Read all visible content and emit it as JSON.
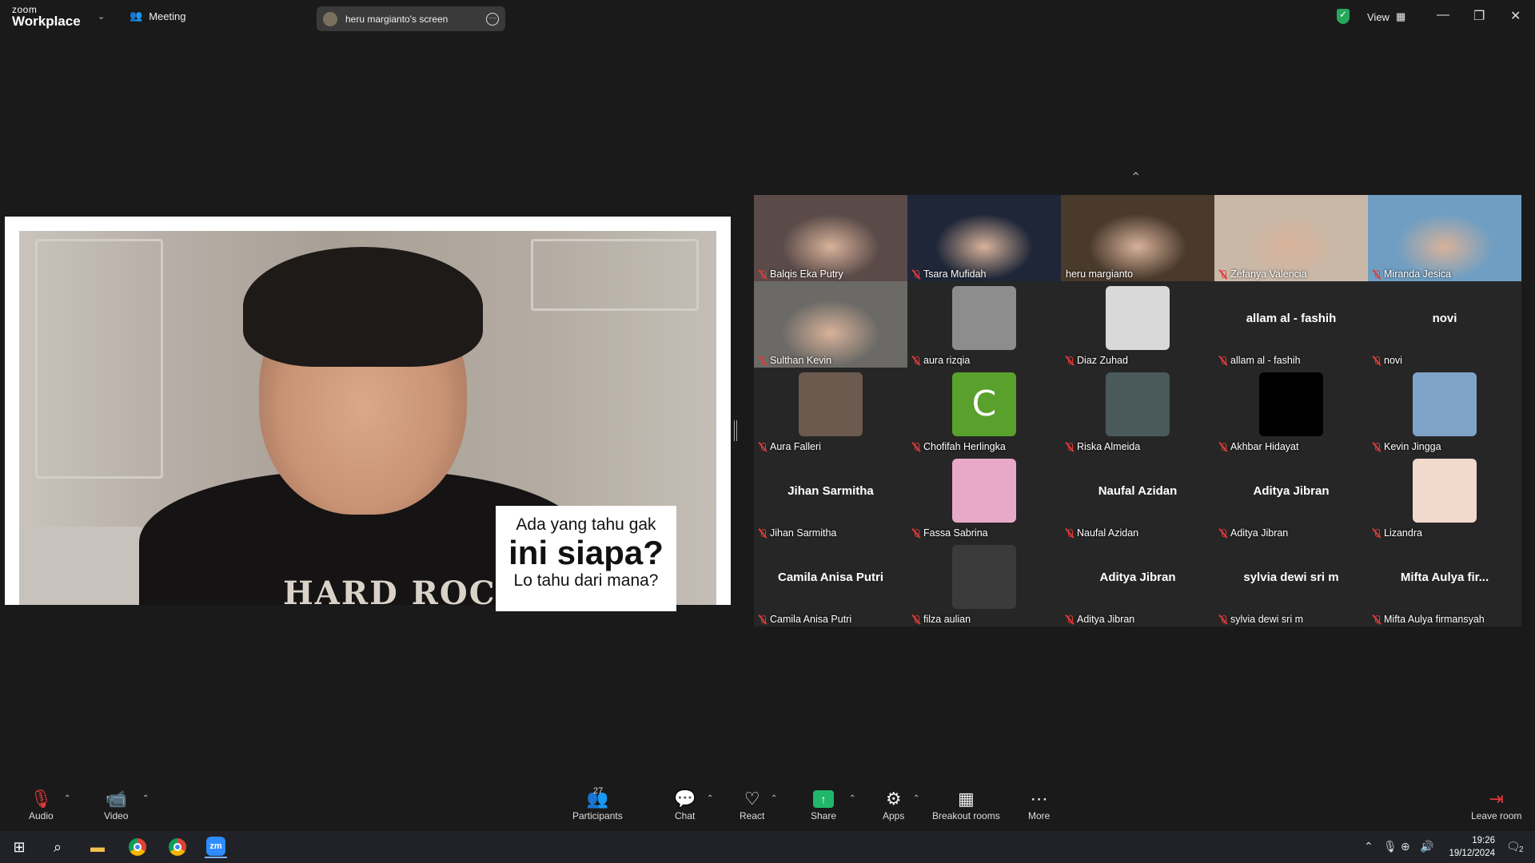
{
  "topbar": {
    "logo_small": "zoom",
    "logo_big": "Workplace",
    "meeting_label": "Meeting",
    "screen_share_label": "heru margianto's screen",
    "view_label": "View",
    "minimize": "—",
    "restore": "❐",
    "close": "✕"
  },
  "shared_screen": {
    "caption_line1": "Ada yang tahu gak",
    "caption_line2": "ini siapa?",
    "caption_line3": "Lo tahu dari mana?",
    "shirt_text": "HARD ROCK"
  },
  "participants": [
    {
      "name": "Balqis Eka Putry",
      "type": "video",
      "bg": "#5a4a48"
    },
    {
      "name": "Tsara Mufidah",
      "type": "video",
      "bg": "#1e2638"
    },
    {
      "name": "heru margianto",
      "type": "video",
      "bg": "#4a3a2c",
      "muted": false
    },
    {
      "name": "Zefanya Valencia",
      "type": "video",
      "bg": "#c9b8a8"
    },
    {
      "name": "Miranda Jesica",
      "type": "video",
      "bg": "#6f9ec2"
    },
    {
      "name": "Sulthan Kevin",
      "type": "video",
      "bg": "#6c6a66"
    },
    {
      "name": "aura rizqia",
      "type": "thumb",
      "bg": "#8d8d8d"
    },
    {
      "name": "Diaz Zuhad",
      "type": "thumb",
      "bg": "#d9d9d9"
    },
    {
      "name": "allam al - fashih",
      "type": "name",
      "big": "allam al - fashih"
    },
    {
      "name": "novi",
      "type": "name",
      "big": "novi"
    },
    {
      "name": "Aura Falleri",
      "type": "thumb",
      "bg": "#6b5a4d"
    },
    {
      "name": "Chofifah Herlingka",
      "type": "letter",
      "bg": "#5aa02c",
      "letter": "C"
    },
    {
      "name": "Riska Almeida",
      "type": "thumb",
      "bg": "#4a5a5a"
    },
    {
      "name": "Akhbar Hidayat",
      "type": "thumb",
      "bg": "#000000"
    },
    {
      "name": "Kevin Jingga",
      "type": "thumb",
      "bg": "#7fa3c8"
    },
    {
      "name": "Jihan Sarmitha",
      "type": "name",
      "big": "Jihan Sarmitha"
    },
    {
      "name": "Fassa Sabrina",
      "type": "thumb",
      "bg": "#e8a9c9"
    },
    {
      "name": "Naufal Azidan",
      "type": "name",
      "big": "Naufal Azidan"
    },
    {
      "name": "Aditya Jibran",
      "type": "name",
      "big": "Aditya Jibran"
    },
    {
      "name": "Lizandra",
      "type": "thumb",
      "bg": "#f1d9cc"
    },
    {
      "name": "Camila Anisa Putri",
      "type": "name",
      "big": "Camila Anisa Putri"
    },
    {
      "name": "filza aulian",
      "type": "thumb",
      "bg": "#3b3b3b"
    },
    {
      "name": "Aditya Jibran",
      "type": "name",
      "big": "Aditya Jibran"
    },
    {
      "name": "sylvia dewi sri m",
      "type": "name",
      "big": "sylvia dewi sri m"
    },
    {
      "name": "Mifta Aulya firmansyah",
      "type": "name",
      "big": "Mifta Aulya fir..."
    }
  ],
  "toolbar": {
    "audio": "Audio",
    "video": "Video",
    "participants": "Participants",
    "participants_count": "27",
    "chat": "Chat",
    "react": "React",
    "share": "Share",
    "apps": "Apps",
    "breakout": "Breakout rooms",
    "more": "More",
    "leave": "Leave room"
  },
  "taskbar": {
    "time": "19:26",
    "date": "19/12/2024",
    "notif_count": "2"
  },
  "colors": {
    "background": "#1a1a1a",
    "muted_red": "#e03a3a",
    "share_green": "#21b76a",
    "zoom_blue": "#2d8cff"
  }
}
